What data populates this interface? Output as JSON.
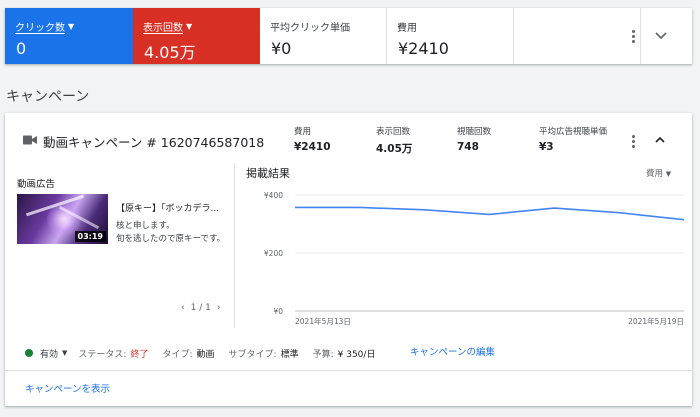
{
  "metrics": [
    {
      "label": "クリック数",
      "value": "0",
      "dropdown": true,
      "style": "blue"
    },
    {
      "label": "表示回数",
      "value": "4.05万",
      "dropdown": true,
      "style": "red"
    },
    {
      "label": "平均クリック単価",
      "value": "¥0",
      "dropdown": false,
      "style": "plain"
    },
    {
      "label": "費用",
      "value": "¥2410",
      "dropdown": false,
      "style": "plain"
    }
  ],
  "colors": {
    "clicks_accent": "#1a73e8",
    "impressions_accent": "#d93025",
    "line": "#4285f4",
    "status_active": "#188038"
  },
  "section_title": "キャンペーン",
  "campaign": {
    "title": "動画キャンペーン # 1620746587018",
    "stats": [
      {
        "label": "費用",
        "value": "¥2410"
      },
      {
        "label": "表示回数",
        "value": "4.05万"
      },
      {
        "label": "視聴回数",
        "value": "748"
      },
      {
        "label": "平均広告視聴単価",
        "value": "¥3"
      }
    ],
    "ad_section_label": "動画広告",
    "ad": {
      "title": "【原キー】「ボッカデラ...",
      "description": "核と申します。\n旬を逃したので原キーです。",
      "duration": "03:19",
      "pager": "1 / 1"
    },
    "results_title": "掲載結果",
    "sort_label": "費用",
    "status": {
      "state": "有効",
      "items": [
        {
          "key": "ステータス:",
          "value": "終了",
          "red": true
        },
        {
          "key": "タイプ:",
          "value": "動画",
          "red": false
        },
        {
          "key": "サブタイプ:",
          "value": "標準",
          "red": false
        },
        {
          "key": "予算:",
          "value": "¥ 350/日",
          "red": false
        }
      ]
    },
    "edit_link": "キャンペーンの編集",
    "view_link": "キャンペーンを表示"
  },
  "chart_data": {
    "type": "line",
    "x": [
      "2021年5月13日",
      "2021年5月14日",
      "2021年5月15日",
      "2021年5月16日",
      "2021年5月17日",
      "2021年5月18日",
      "2021年5月19日"
    ],
    "x_tick_labels": [
      "2021年5月13日",
      "2021年5月19日"
    ],
    "series": [
      {
        "values": [
          357,
          357,
          349,
          333,
          355,
          339,
          315
        ]
      }
    ],
    "y_tick_labels": [
      "¥400",
      "¥200",
      "¥0"
    ],
    "ylim": [
      0,
      400
    ],
    "grid": true
  }
}
